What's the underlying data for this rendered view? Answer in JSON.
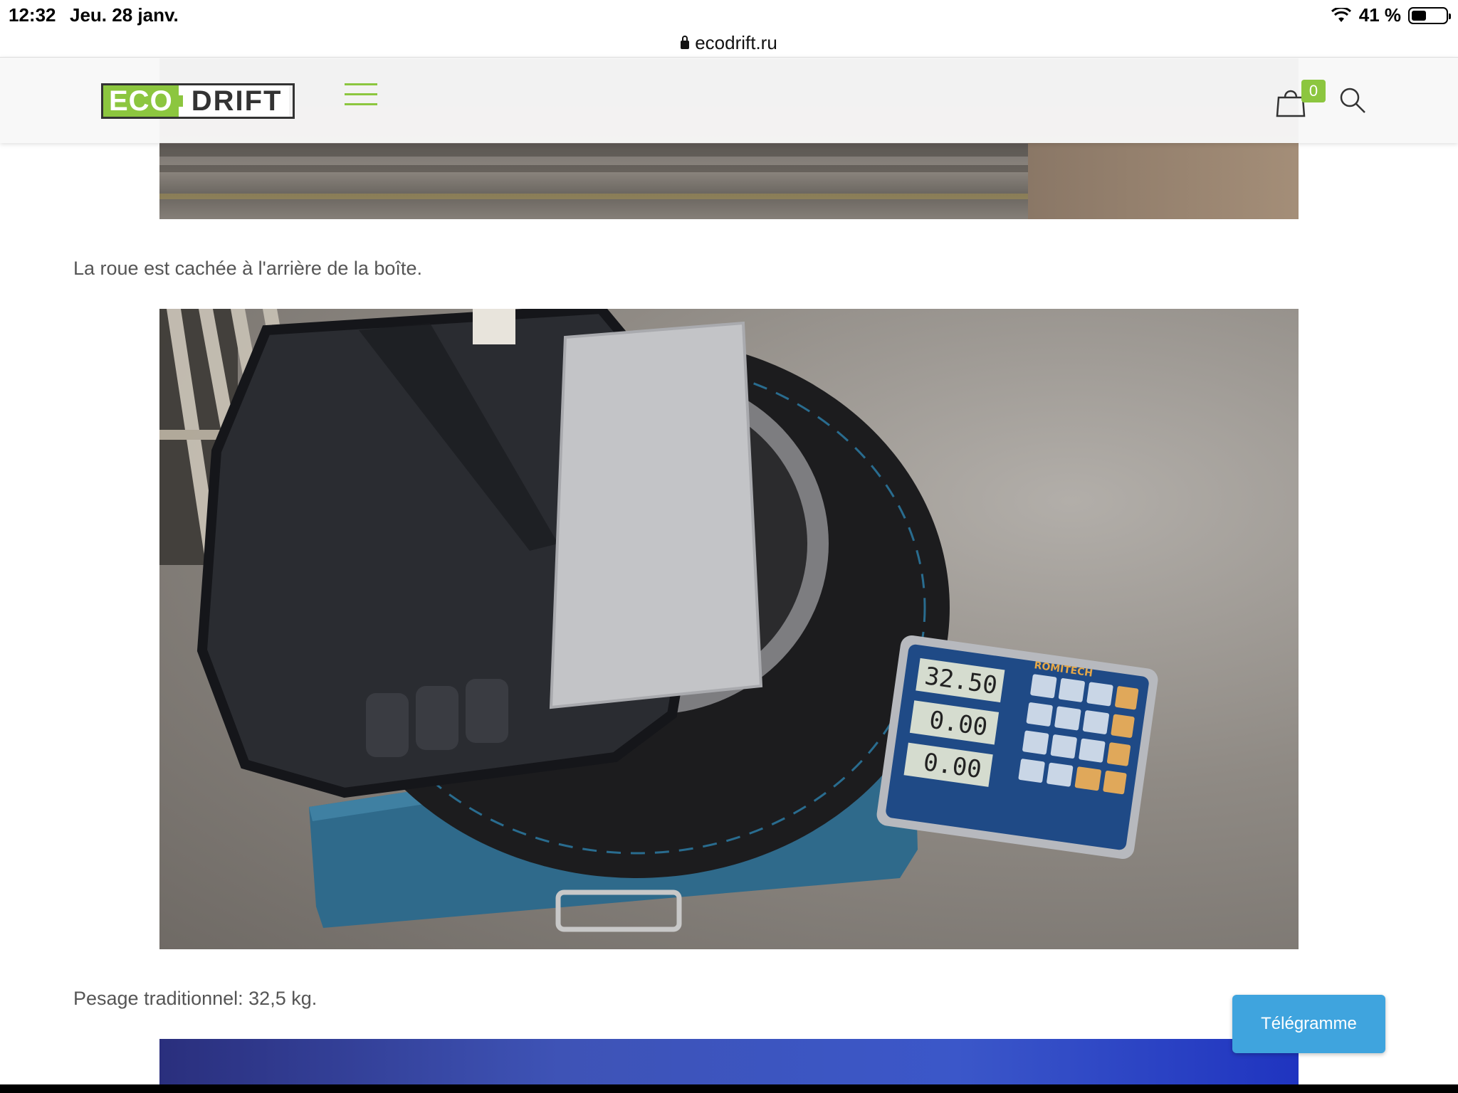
{
  "status_bar": {
    "time": "12:32",
    "date": "Jeu. 28 janv.",
    "battery_text": "41 %",
    "icons": [
      "wifi-icon",
      "battery-icon"
    ]
  },
  "url_bar": {
    "domain": "ecodrift.ru",
    "icon": "lock-icon"
  },
  "header": {
    "logo_eco": "ECO",
    "logo_drift": "DRIFT",
    "menu_icon": "hamburger-icon",
    "cart_count": "0",
    "cart_icon": "shopping-bag-icon",
    "search_icon": "search-icon",
    "accent_color": "#8cc63f"
  },
  "content": {
    "caption_1": "La roue est cachée à l'arrière de la boîte.",
    "caption_2": "Pesage traditionnel: 32,5 kg.",
    "scale_display": {
      "line1": "32.50",
      "line2": "0.00",
      "line3": "0.00",
      "brand": "ROMITECH"
    }
  },
  "telegram_button": {
    "label": "Télégramme",
    "color": "#3fa4de"
  }
}
